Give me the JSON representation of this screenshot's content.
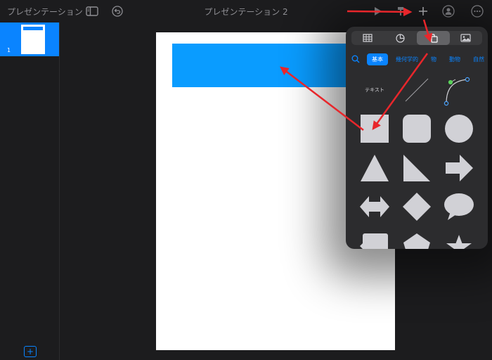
{
  "app": {
    "doc_name": "プレゼンテーション",
    "title": "プレゼンテーション 2"
  },
  "sidebar": {
    "slides": [
      {
        "number": "1"
      }
    ],
    "add_slide_label": "+"
  },
  "popover": {
    "tabs": [
      {
        "icon": "table-icon"
      },
      {
        "icon": "chart-icon"
      },
      {
        "icon": "shape-icon",
        "active": true
      },
      {
        "icon": "media-icon"
      }
    ],
    "categories": [
      {
        "label": "基本",
        "active": true
      },
      {
        "label": "幾何学的"
      },
      {
        "label": "物"
      },
      {
        "label": "動物"
      },
      {
        "label": "自然"
      }
    ],
    "shapes": [
      {
        "name": "text-shape",
        "label": "テキスト"
      },
      {
        "name": "line-shape"
      },
      {
        "name": "curve-shape"
      },
      {
        "name": "square-shape"
      },
      {
        "name": "rounded-square-shape"
      },
      {
        "name": "circle-shape"
      },
      {
        "name": "triangle-shape"
      },
      {
        "name": "right-triangle-shape"
      },
      {
        "name": "arrow-shape"
      },
      {
        "name": "double-arrow-shape"
      },
      {
        "name": "diamond-shape"
      },
      {
        "name": "speech-bubble-shape"
      },
      {
        "name": "callout-shape"
      },
      {
        "name": "pentagon-shape"
      },
      {
        "name": "star-shape"
      }
    ]
  },
  "colors": {
    "accent": "#0a84ff",
    "shape_fill": "#d1d1d6",
    "annotation": "#e8262b"
  }
}
